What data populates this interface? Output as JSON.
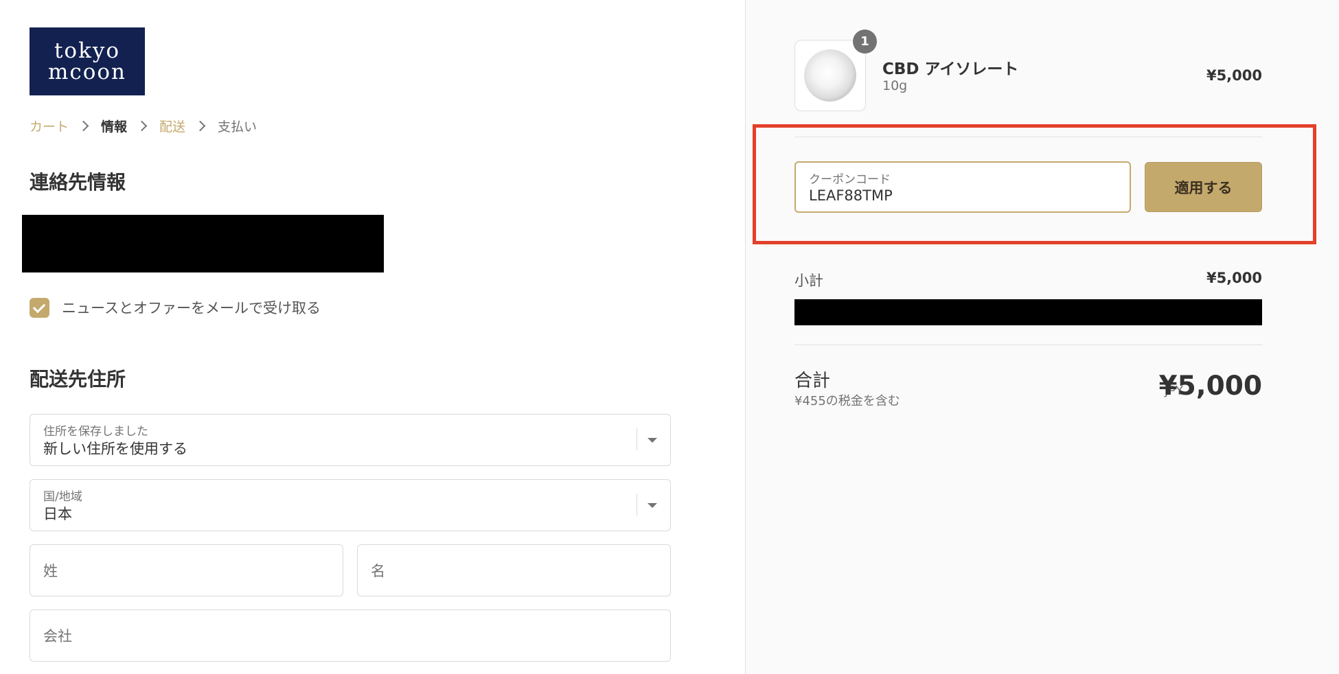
{
  "logo": {
    "line1": "tokyo",
    "line2": "mcoon"
  },
  "breadcrumb": [
    {
      "label": "カート"
    },
    {
      "label": "情報"
    },
    {
      "label": "配送"
    },
    {
      "label": "支払い"
    }
  ],
  "contact": {
    "title": "連絡先情報",
    "newsletter_label": "ニュースとオファーをメールで受け取る",
    "newsletter_checked": true
  },
  "shipping": {
    "title": "配送先住所",
    "saved_address": {
      "label": "住所を保存しました",
      "value": "新しい住所を使用する"
    },
    "country": {
      "label": "国/地域",
      "value": "日本"
    },
    "last_name_placeholder": "姓",
    "first_name_placeholder": "名",
    "company_placeholder": "会社"
  },
  "cart": {
    "item": {
      "name": "CBD アイソレート",
      "variant": "10g",
      "price": "¥5,000",
      "quantity": "1"
    },
    "coupon": {
      "label": "クーポンコード",
      "value": "LEAF88TMP",
      "apply_label": "適用する"
    },
    "subtotal_label": "小計",
    "subtotal_value": "¥5,000",
    "total_label": "合計",
    "tax_note": "¥455の税金を含む",
    "currency": "JPY",
    "total_value": "¥5,000"
  },
  "colors": {
    "accent": "#c4a96d",
    "logo_bg": "#122150",
    "highlight": "#e3402b",
    "sidebar_bg": "#fafafa"
  }
}
